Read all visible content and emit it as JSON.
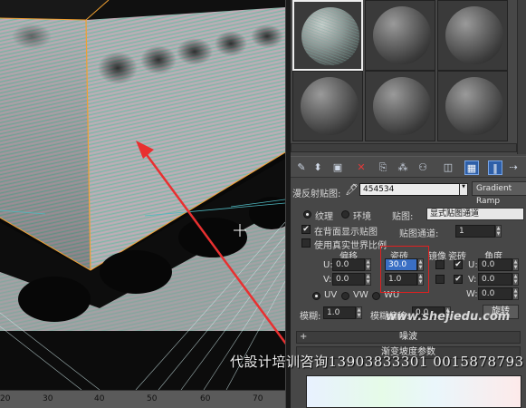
{
  "viewport": {
    "timeline_ticks": [
      "20",
      "30",
      "40",
      "50",
      "60",
      "70"
    ],
    "colors": {
      "arrow": "#e83030",
      "selection": "#f0a030"
    }
  },
  "material_editor": {
    "material_slots": [
      "slot-1",
      "slot-2",
      "slot-3",
      "slot-4",
      "slot-5",
      "slot-6"
    ],
    "map_label": "漫反射贴图:",
    "map_name": "454534",
    "map_type": "Gradient Ramp",
    "coordinates": {
      "texture_label": "纹理",
      "environ_label": "环境",
      "mapping_label": "贴图:",
      "mapping_value": "显式贴图通道",
      "show_on_back": "在背面显示贴图",
      "map_channel_label": "贴图通道:",
      "map_channel_value": "1",
      "real_world": "使用真实世界比例",
      "offset_label": "偏移",
      "tiling_label": "瓷砖",
      "mirror_label": "镜像",
      "tile_label": "瓷砖",
      "angle_label": "角度",
      "u_label": "U:",
      "v_label": "V:",
      "w_label": "W:",
      "u_offset": "0.0",
      "v_offset": "0.0",
      "u_tiling": "30.0",
      "v_tiling": "1.0",
      "u_angle": "0.0",
      "v_angle": "0.0",
      "w_angle": "0.0",
      "uv": "UV",
      "vw": "VW",
      "wu": "WU",
      "blur_label": "模糊:",
      "blur_value": "1.0",
      "blur_offset_label": "模糊偏移:",
      "blur_offset_value": "0.0",
      "rotate_button": "旋转"
    },
    "noise_rollout": "噪波",
    "gradient_params": "渐变坡度参数"
  },
  "overlay": {
    "site_url": "www.shejiedu.com",
    "watermark": "代設计培训咨询13903833301 0015878793"
  }
}
